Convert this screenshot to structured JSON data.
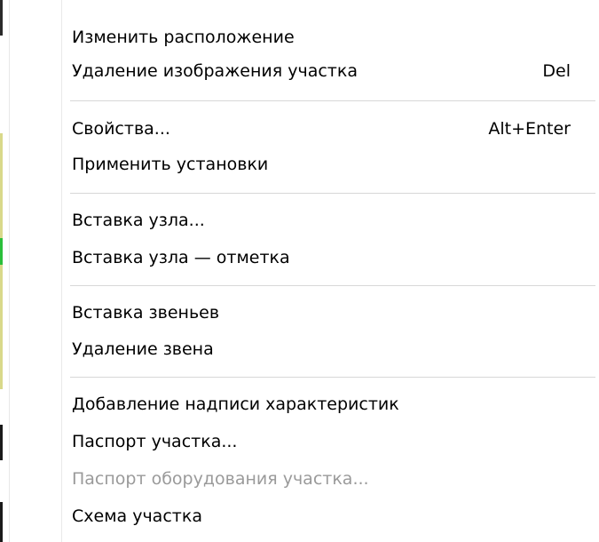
{
  "menu": {
    "items": [
      {
        "label": "Изменить расположение",
        "shortcut": "",
        "enabled": true
      },
      {
        "label": "Удаление изображения участка",
        "shortcut": "Del",
        "enabled": true
      },
      {
        "label": "Свойства...",
        "shortcut": "Alt+Enter",
        "enabled": true
      },
      {
        "label": "Применить установки",
        "shortcut": "",
        "enabled": true
      },
      {
        "label": "Вставка узла...",
        "shortcut": "",
        "enabled": true
      },
      {
        "label": "Вставка узла — отметка",
        "shortcut": "",
        "enabled": true
      },
      {
        "label": "Вставка звеньев",
        "shortcut": "",
        "enabled": true
      },
      {
        "label": "Удаление звена",
        "shortcut": "",
        "enabled": true
      },
      {
        "label": "Добавление надписи характеристик",
        "shortcut": "",
        "enabled": true
      },
      {
        "label": "Паспорт участка...",
        "shortcut": "",
        "enabled": true
      },
      {
        "label": "Паспорт оборудования участка...",
        "shortcut": "",
        "enabled": false
      },
      {
        "label": "Схема  участка",
        "shortcut": "",
        "enabled": true
      }
    ]
  }
}
